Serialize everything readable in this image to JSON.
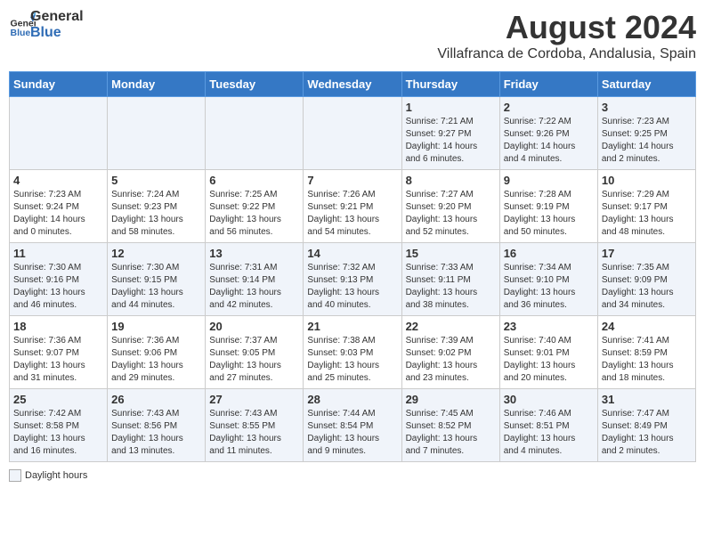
{
  "logo": {
    "line1": "General",
    "line2": "Blue"
  },
  "title": "August 2024",
  "subtitle": "Villafranca de Cordoba, Andalusia, Spain",
  "days_of_week": [
    "Sunday",
    "Monday",
    "Tuesday",
    "Wednesday",
    "Thursday",
    "Friday",
    "Saturday"
  ],
  "weeks": [
    [
      {
        "day": "",
        "content": ""
      },
      {
        "day": "",
        "content": ""
      },
      {
        "day": "",
        "content": ""
      },
      {
        "day": "",
        "content": ""
      },
      {
        "day": "1",
        "content": "Sunrise: 7:21 AM\nSunset: 9:27 PM\nDaylight: 14 hours\nand 6 minutes."
      },
      {
        "day": "2",
        "content": "Sunrise: 7:22 AM\nSunset: 9:26 PM\nDaylight: 14 hours\nand 4 minutes."
      },
      {
        "day": "3",
        "content": "Sunrise: 7:23 AM\nSunset: 9:25 PM\nDaylight: 14 hours\nand 2 minutes."
      }
    ],
    [
      {
        "day": "4",
        "content": "Sunrise: 7:23 AM\nSunset: 9:24 PM\nDaylight: 14 hours\nand 0 minutes."
      },
      {
        "day": "5",
        "content": "Sunrise: 7:24 AM\nSunset: 9:23 PM\nDaylight: 13 hours\nand 58 minutes."
      },
      {
        "day": "6",
        "content": "Sunrise: 7:25 AM\nSunset: 9:22 PM\nDaylight: 13 hours\nand 56 minutes."
      },
      {
        "day": "7",
        "content": "Sunrise: 7:26 AM\nSunset: 9:21 PM\nDaylight: 13 hours\nand 54 minutes."
      },
      {
        "day": "8",
        "content": "Sunrise: 7:27 AM\nSunset: 9:20 PM\nDaylight: 13 hours\nand 52 minutes."
      },
      {
        "day": "9",
        "content": "Sunrise: 7:28 AM\nSunset: 9:19 PM\nDaylight: 13 hours\nand 50 minutes."
      },
      {
        "day": "10",
        "content": "Sunrise: 7:29 AM\nSunset: 9:17 PM\nDaylight: 13 hours\nand 48 minutes."
      }
    ],
    [
      {
        "day": "11",
        "content": "Sunrise: 7:30 AM\nSunset: 9:16 PM\nDaylight: 13 hours\nand 46 minutes."
      },
      {
        "day": "12",
        "content": "Sunrise: 7:30 AM\nSunset: 9:15 PM\nDaylight: 13 hours\nand 44 minutes."
      },
      {
        "day": "13",
        "content": "Sunrise: 7:31 AM\nSunset: 9:14 PM\nDaylight: 13 hours\nand 42 minutes."
      },
      {
        "day": "14",
        "content": "Sunrise: 7:32 AM\nSunset: 9:13 PM\nDaylight: 13 hours\nand 40 minutes."
      },
      {
        "day": "15",
        "content": "Sunrise: 7:33 AM\nSunset: 9:11 PM\nDaylight: 13 hours\nand 38 minutes."
      },
      {
        "day": "16",
        "content": "Sunrise: 7:34 AM\nSunset: 9:10 PM\nDaylight: 13 hours\nand 36 minutes."
      },
      {
        "day": "17",
        "content": "Sunrise: 7:35 AM\nSunset: 9:09 PM\nDaylight: 13 hours\nand 34 minutes."
      }
    ],
    [
      {
        "day": "18",
        "content": "Sunrise: 7:36 AM\nSunset: 9:07 PM\nDaylight: 13 hours\nand 31 minutes."
      },
      {
        "day": "19",
        "content": "Sunrise: 7:36 AM\nSunset: 9:06 PM\nDaylight: 13 hours\nand 29 minutes."
      },
      {
        "day": "20",
        "content": "Sunrise: 7:37 AM\nSunset: 9:05 PM\nDaylight: 13 hours\nand 27 minutes."
      },
      {
        "day": "21",
        "content": "Sunrise: 7:38 AM\nSunset: 9:03 PM\nDaylight: 13 hours\nand 25 minutes."
      },
      {
        "day": "22",
        "content": "Sunrise: 7:39 AM\nSunset: 9:02 PM\nDaylight: 13 hours\nand 23 minutes."
      },
      {
        "day": "23",
        "content": "Sunrise: 7:40 AM\nSunset: 9:01 PM\nDaylight: 13 hours\nand 20 minutes."
      },
      {
        "day": "24",
        "content": "Sunrise: 7:41 AM\nSunset: 8:59 PM\nDaylight: 13 hours\nand 18 minutes."
      }
    ],
    [
      {
        "day": "25",
        "content": "Sunrise: 7:42 AM\nSunset: 8:58 PM\nDaylight: 13 hours\nand 16 minutes."
      },
      {
        "day": "26",
        "content": "Sunrise: 7:43 AM\nSunset: 8:56 PM\nDaylight: 13 hours\nand 13 minutes."
      },
      {
        "day": "27",
        "content": "Sunrise: 7:43 AM\nSunset: 8:55 PM\nDaylight: 13 hours\nand 11 minutes."
      },
      {
        "day": "28",
        "content": "Sunrise: 7:44 AM\nSunset: 8:54 PM\nDaylight: 13 hours\nand 9 minutes."
      },
      {
        "day": "29",
        "content": "Sunrise: 7:45 AM\nSunset: 8:52 PM\nDaylight: 13 hours\nand 7 minutes."
      },
      {
        "day": "30",
        "content": "Sunrise: 7:46 AM\nSunset: 8:51 PM\nDaylight: 13 hours\nand 4 minutes."
      },
      {
        "day": "31",
        "content": "Sunrise: 7:47 AM\nSunset: 8:49 PM\nDaylight: 13 hours\nand 2 minutes."
      }
    ]
  ],
  "legend": {
    "daylight_label": "Daylight hours"
  },
  "colors": {
    "header_bg": "#3578c5",
    "odd_row": "#f0f4fa",
    "even_row": "#ffffff"
  }
}
